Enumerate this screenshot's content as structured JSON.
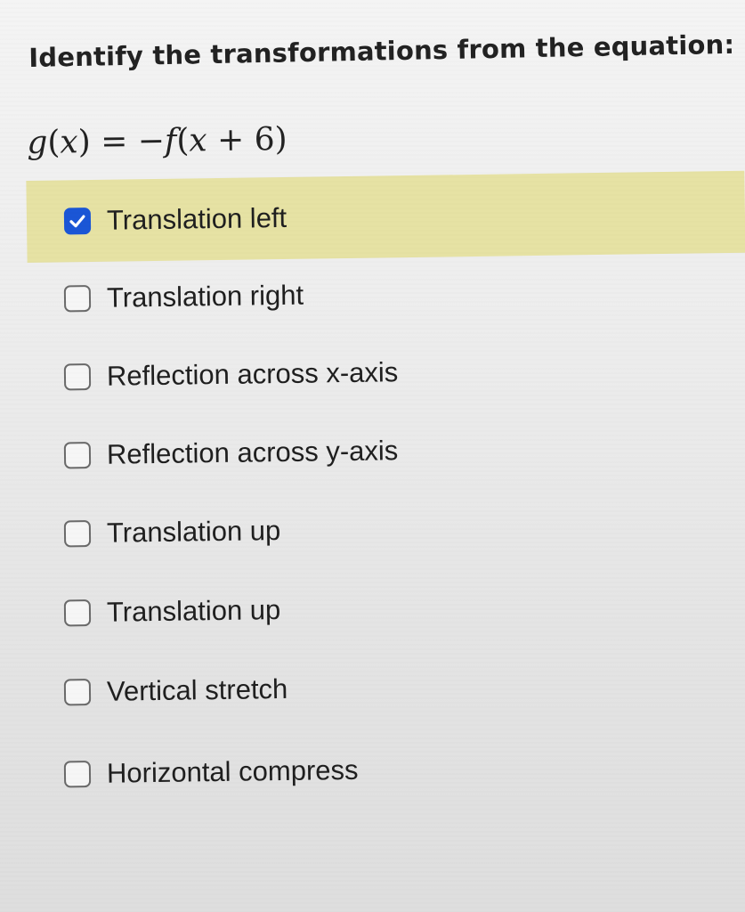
{
  "question": {
    "prompt": "Identify the transformations from the equation:",
    "equation": {
      "g": "g",
      "x1": "x",
      "eq": "=",
      "neg": "−",
      "f": "f",
      "x2": "x",
      "plus": "+",
      "six": "6"
    }
  },
  "options": [
    {
      "label": "Translation left",
      "checked": true
    },
    {
      "label": "Translation right",
      "checked": false
    },
    {
      "label": "Reflection across x-axis",
      "checked": false
    },
    {
      "label": "Reflection across y-axis",
      "checked": false
    },
    {
      "label": "Translation up",
      "checked": false
    },
    {
      "label": "Translation up",
      "checked": false
    },
    {
      "label": "Vertical stretch",
      "checked": false
    },
    {
      "label": "Horizontal compress",
      "checked": false
    }
  ],
  "colors": {
    "selected_highlight": "#e6e2a4",
    "checkbox_checked": "#1a56d6",
    "checkbox_border": "#6a6a6a"
  },
  "icons": {
    "checked": "checkmark-icon"
  }
}
